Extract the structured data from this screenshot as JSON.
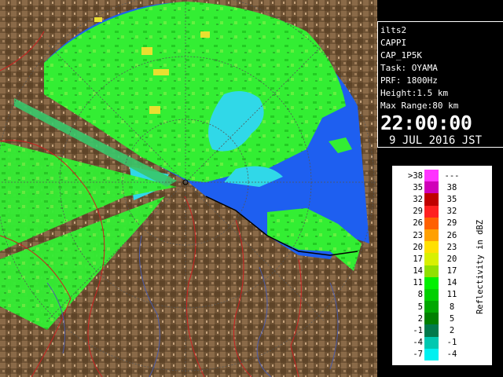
{
  "info": {
    "lines": [
      "ilts2",
      "CAPPI",
      "CAP_1P5K",
      "Task: OYAMA",
      "PRF: 1800Hz",
      "Height:1.5 km",
      "Max Range:80 km"
    ],
    "time": "22:00:00",
    "date": "9 JUL 2016 JST"
  },
  "legend": {
    "title": "Reflectivity in dBZ",
    "rows": [
      {
        "lo": ">38",
        "hi": "---",
        "color": "#ff33ff"
      },
      {
        "lo": "35",
        "hi": "38",
        "color": "#d000b8"
      },
      {
        "lo": "32",
        "hi": "35",
        "color": "#c00000"
      },
      {
        "lo": "29",
        "hi": "32",
        "color": "#ff2020"
      },
      {
        "lo": "26",
        "hi": "29",
        "color": "#ff6000"
      },
      {
        "lo": "23",
        "hi": "26",
        "color": "#ffa000"
      },
      {
        "lo": "20",
        "hi": "23",
        "color": "#ffe000"
      },
      {
        "lo": "17",
        "hi": "20",
        "color": "#d8f000"
      },
      {
        "lo": "14",
        "hi": "17",
        "color": "#90e000"
      },
      {
        "lo": "11",
        "hi": "14",
        "color": "#00f000"
      },
      {
        "lo": "8",
        "hi": "11",
        "color": "#00d000"
      },
      {
        "lo": "5",
        "hi": "8",
        "color": "#00a800"
      },
      {
        "lo": "2",
        "hi": "5",
        "color": "#008000"
      },
      {
        "lo": "-1",
        "hi": "2",
        "color": "#007a4c"
      },
      {
        "lo": "-4",
        "hi": "-1",
        "color": "#00c8b0"
      },
      {
        "lo": "-7",
        "hi": "-4",
        "color": "#00f0f0"
      }
    ]
  },
  "colors": {
    "sea_echo": "#1e5ff0",
    "weak_echo": "#33ff33",
    "land": "#7a5c3e",
    "rivers": "#4a5aa8",
    "prefecture_lines": "#cc2020",
    "background": "#000000"
  }
}
